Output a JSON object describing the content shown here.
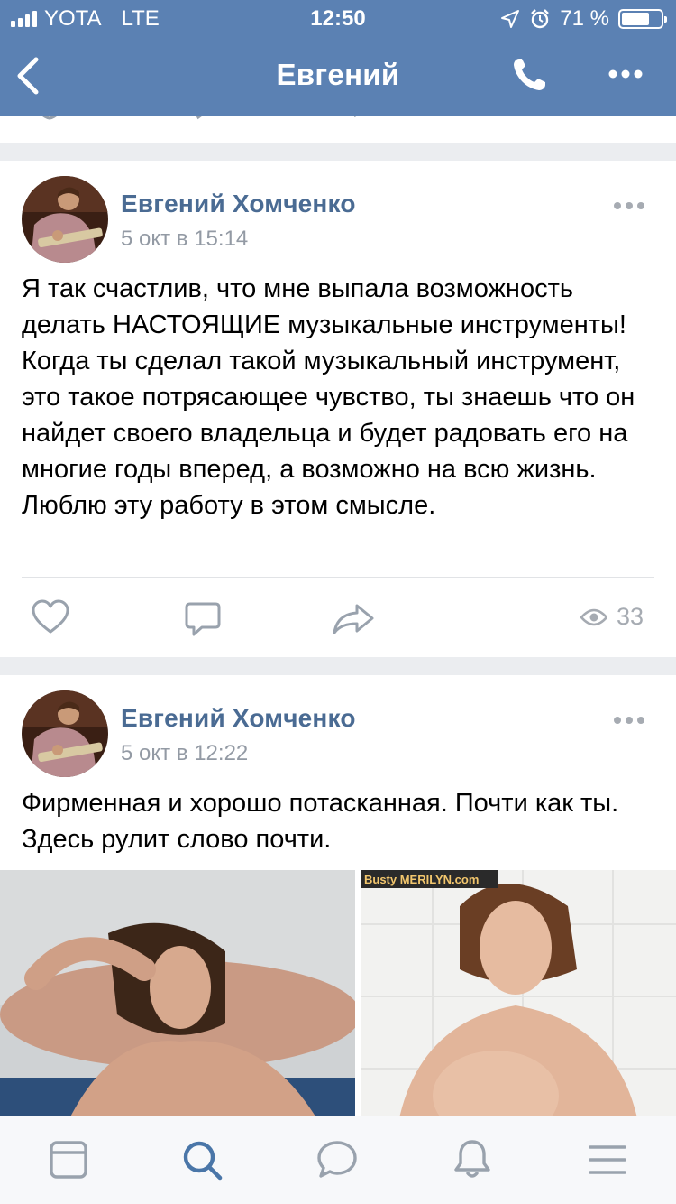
{
  "status_bar": {
    "carrier": "YOTA",
    "network": "LTE",
    "time": "12:50",
    "battery_percent": "71 %",
    "battery_level": 0.71
  },
  "nav": {
    "title": "Евгений",
    "back_icon": "chevron-left-icon",
    "call_icon": "phone-icon",
    "menu_icon": "more-horizontal-icon"
  },
  "posts": [
    {
      "author": "Евгений Хомченко",
      "time": "5 окт в 15:14",
      "text": "Я так счастлив, что мне выпала возможность делать НАСТОЯЩИЕ музыкальные инструменты! Когда ты сделал такой музыкальный инструмент, это такое потрясающее чувство, ты знаешь что он найдет своего владельца и будет радовать его на многие годы вперед, а возможно на всю жизнь. Люблю эту работу в этом смысле.",
      "views": "33"
    },
    {
      "author": "Евгений Хомченко",
      "time": "5 окт в 12:22",
      "text": "Фирменная и хорошо потасканная. Почти как ты. Здесь рулит слово почти.",
      "photo_watermark": "Busty MERILYN.com"
    }
  ],
  "tabbar": {
    "items": [
      "news-icon",
      "search-icon",
      "messages-icon",
      "notifications-icon",
      "menu-icon"
    ],
    "active": "search-icon"
  },
  "colors": {
    "header": "#5b81b3",
    "author": "#4a6b93",
    "meta": "#939aa4",
    "icons": "#99a2ad",
    "active_tab": "#4a76a8"
  }
}
